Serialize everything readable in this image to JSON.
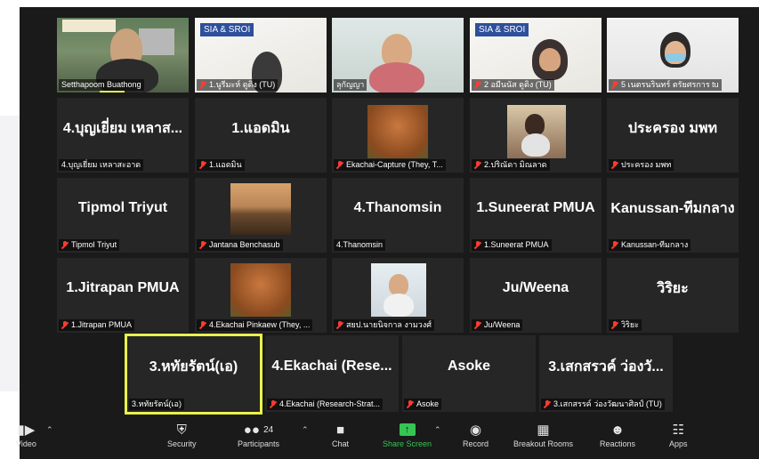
{
  "tiles": [
    {
      "label": "Setthapoom Buathong",
      "big": "",
      "muted": false
    },
    {
      "label": "1.นูรีมะห์ ดูดิง (TU)",
      "big": "",
      "muted": true,
      "slide": "SIA & SROI"
    },
    {
      "label": "ลุกัญญา",
      "big": "",
      "muted": false
    },
    {
      "label": "2 อมีนนัส ดูดิง (TU)",
      "big": "",
      "muted": true,
      "slide": "SIA & SROI"
    },
    {
      "label": "5 เนตรนรินทร์ ตรัยศรการ tu",
      "big": "",
      "muted": true
    },
    {
      "label": "4.บุญเยี่ยม เหลาสะอาด",
      "big": "4.บุญเยี่ยม เหลาส...",
      "muted": false
    },
    {
      "label": "1.แอดมิน",
      "big": "1.แอดมิน",
      "muted": true
    },
    {
      "label": "Ekachai-Capture (They, T...",
      "big": "",
      "muted": true
    },
    {
      "label": "2.ปริณัดา มิณลาด",
      "big": "",
      "muted": true
    },
    {
      "label": "ประครอง มพท",
      "big": "ประครอง มพท",
      "muted": true
    },
    {
      "label": "Tipmol Triyut",
      "big": "Tipmol Triyut",
      "muted": true
    },
    {
      "label": "Jantana Benchasub",
      "big": "",
      "muted": true
    },
    {
      "label": "4.Thanomsin",
      "big": "4.Thanomsin",
      "muted": false
    },
    {
      "label": "1.Suneerat PMUA",
      "big": "1.Suneerat PMUA",
      "muted": true
    },
    {
      "label": "Kanussan-ทีมกลาง",
      "big": "Kanussan-ทีมกลาง",
      "muted": true
    },
    {
      "label": "1.Jitrapan PMUA",
      "big": "1.Jitrapan PMUA",
      "muted": true
    },
    {
      "label": "4.Ekachai Pinkaew (They, ...",
      "big": "",
      "muted": true
    },
    {
      "label": "สยป.นายนิจกาล งามวงศ์",
      "big": "",
      "muted": true
    },
    {
      "label": "Ju/Weena",
      "big": "Ju/Weena",
      "muted": true
    },
    {
      "label": "วิริยะ",
      "big": "วิริยะ",
      "muted": true
    },
    {
      "label": "3.หทัยรัตน์(เอ)",
      "big": "3.หทัยรัตน์(เอ)",
      "muted": false
    },
    {
      "label": "4.Ekachai (Research-Strat...",
      "big": "4.Ekachai  (Rese...",
      "muted": true
    },
    {
      "label": "Asoke",
      "big": "Asoke",
      "muted": true
    },
    {
      "label": "3.เสกสรรค์ ว่องวัฒนาศิลป์ (TU)",
      "big": "3.เสกสรวค์ ว่องวั...",
      "muted": true
    }
  ],
  "toolbar": {
    "video": "Video",
    "security": "Security",
    "participants": "Participants",
    "participants_count": "24",
    "chat": "Chat",
    "share": "Share Screen",
    "record": "Record",
    "breakout": "Breakout Rooms",
    "reactions": "Reactions",
    "apps": "Apps"
  },
  "colors": {
    "active_border": "#e9f34a",
    "share_green": "#35c553",
    "muted_red": "#ff3b30"
  }
}
